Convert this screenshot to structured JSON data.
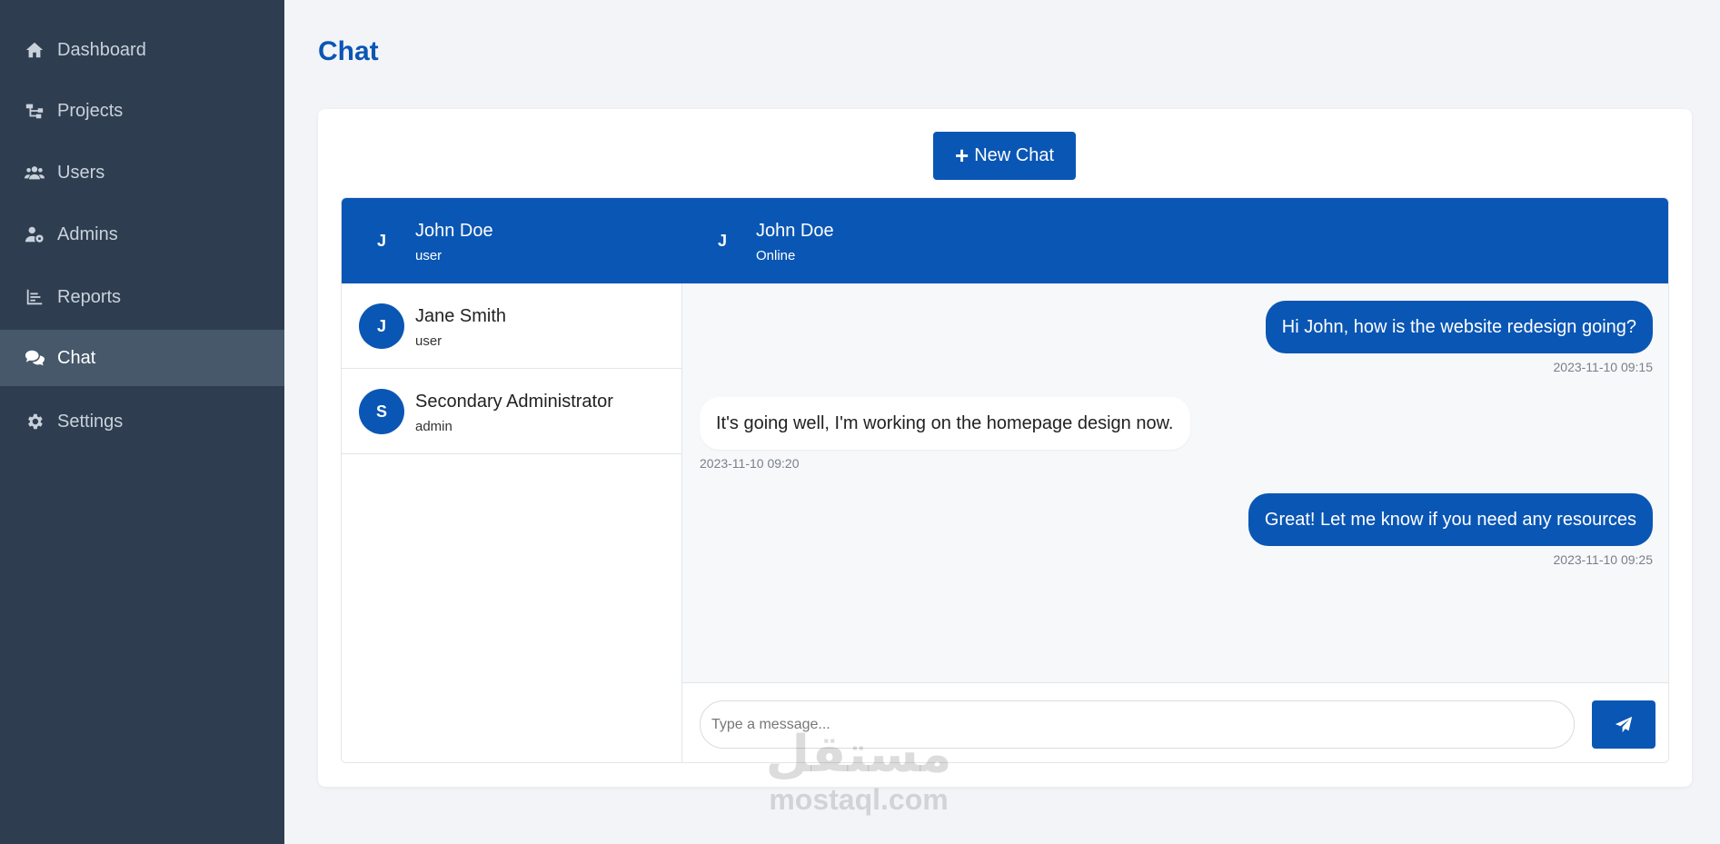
{
  "sidebar": {
    "items": [
      {
        "label": "Dashboard",
        "icon": "home-icon"
      },
      {
        "label": "Projects",
        "icon": "sitemap-icon"
      },
      {
        "label": "Users",
        "icon": "users-icon"
      },
      {
        "label": "Admins",
        "icon": "user-cog-icon"
      },
      {
        "label": "Reports",
        "icon": "chart-icon"
      },
      {
        "label": "Chat",
        "icon": "comments-icon",
        "active": true
      },
      {
        "label": "Settings",
        "icon": "gear-icon"
      }
    ]
  },
  "page": {
    "title": "Chat"
  },
  "new_chat": {
    "label": "New Chat"
  },
  "contacts": [
    {
      "initial": "J",
      "name": "John Doe",
      "role": "user",
      "active": true
    },
    {
      "initial": "J",
      "name": "Jane Smith",
      "role": "user"
    },
    {
      "initial": "S",
      "name": "Secondary Administrator",
      "role": "admin"
    }
  ],
  "conversation": {
    "initial": "J",
    "name": "John Doe",
    "status": "Online",
    "messages": [
      {
        "direction": "out",
        "text": "Hi John, how is the website redesign going?",
        "time": "2023-11-10 09:15"
      },
      {
        "direction": "in",
        "text": "It's going well, I'm working on the homepage design now.",
        "time": "2023-11-10 09:20"
      },
      {
        "direction": "out",
        "text": "Great! Let me know if you need any resources",
        "time": "2023-11-10 09:25"
      }
    ]
  },
  "composer": {
    "placeholder": "Type a message...",
    "send_icon": "paper-plane-icon"
  },
  "watermark": {
    "logo": "مستقل",
    "text": "mostaql.com"
  },
  "colors": {
    "sidebar": "#2e3e50",
    "sidebar_active": "#47586a",
    "accent": "#0a56b4",
    "background": "#f3f4f8"
  }
}
